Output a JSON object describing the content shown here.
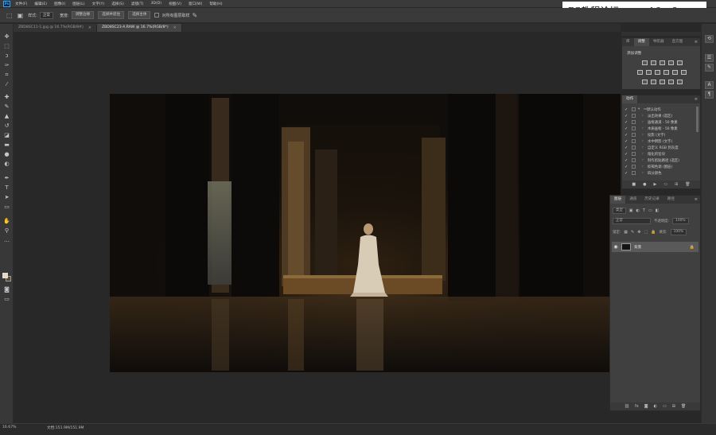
{
  "menu": {
    "logo": "Ps",
    "items": [
      "文件(F)",
      "编辑(E)",
      "图像(I)",
      "图层(L)",
      "文字(Y)",
      "选择(S)",
      "滤镜(T)",
      "3D(D)",
      "视图(V)",
      "窗口(W)",
      "帮助(H)"
    ]
  },
  "watermark": "PS教程论坛 www.16xx8.com",
  "options": {
    "style_label": "样式:",
    "style_value": "正常",
    "width_label": "宽度:",
    "button1": "调整边缘",
    "button2": "选择并遮住",
    "button3": "选择主体",
    "checkbox_label": "对所有图层取样"
  },
  "tabs": [
    {
      "label": "ZBD8SC11-1.jpg @ 16.7%(RGB/8#)"
    },
    {
      "label": "ZBD8SC23-A.RAW @ 16.7%(RGB/8*)"
    }
  ],
  "status": {
    "zoom": "16.67%",
    "doc": "文档:151.9M/151.9M"
  },
  "adjust_panel": {
    "tabs": [
      "库",
      "调整",
      "导航器",
      "直方图"
    ],
    "active_tab": "调整",
    "title": "添加调整"
  },
  "actions_panel": {
    "tab": "动作",
    "rows": [
      {
        "label": "默认动作",
        "indent": 0,
        "folder": true
      },
      {
        "label": "淡出效果 (选区)",
        "indent": 1
      },
      {
        "label": "画框通道 - 50 像素",
        "indent": 1
      },
      {
        "label": "木质画框 - 50 像素",
        "indent": 1
      },
      {
        "label": "投影 (文字)",
        "indent": 1
      },
      {
        "label": "水中倒影 (文字)",
        "indent": 1
      },
      {
        "label": "自定义 RGB 到灰度",
        "indent": 1
      },
      {
        "label": "熔化的铅块",
        "indent": 1
      },
      {
        "label": "制作剪贴路径 (选区)",
        "indent": 1
      },
      {
        "label": "棕褐色调 (图层)",
        "indent": 1
      },
      {
        "label": "四分颜色",
        "indent": 1
      }
    ]
  },
  "layers_panel": {
    "tabs": [
      "图层",
      "通道",
      "历史记录",
      "路径"
    ],
    "active_tab": "图层",
    "filter": "类型",
    "blend_mode": "正常",
    "opacity_label": "不透明度:",
    "opacity_value": "100%",
    "lock_label": "锁定:",
    "fill_label": "填充:",
    "fill_value": "100%",
    "layer_name": "背景"
  },
  "colors": {
    "foreground": "#e9d9b9",
    "background": "#5c4a2c",
    "accent": "#31a8ff"
  }
}
